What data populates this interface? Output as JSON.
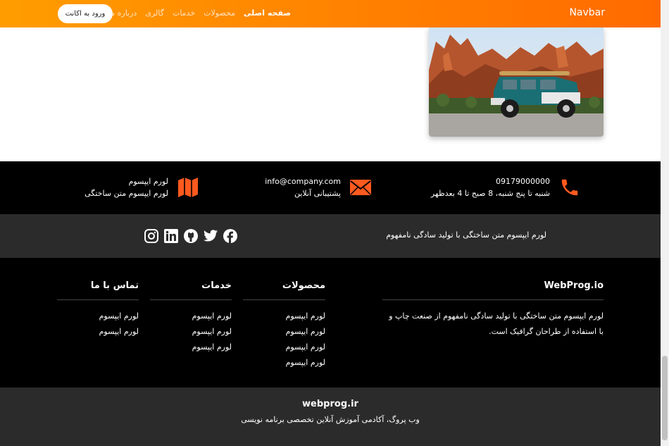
{
  "navbar": {
    "brand": "Navbar",
    "links": [
      "صفحه اصلی",
      "محصولات",
      "خدمات",
      "گالری",
      "درباره ما"
    ],
    "login_label": "ورود به اکانت",
    "accent_color": "#ff7a00"
  },
  "contact": {
    "phone": "09179000000",
    "hours": "شنبه تا پنج شنبه، 8 صبح تا 4 بعدظهر",
    "email": "info@company.com",
    "support": "پشتیبانی آنلاین",
    "address_title": "لورم ایپسوم",
    "address_text": "لورم ایپسوم متن ساختگی"
  },
  "social": {
    "text": "لورم ایپسوم متن ساختگی با تولید سادگی نامفهوم",
    "icons": [
      "facebook-icon",
      "twitter-icon",
      "github-icon",
      "linkedin-icon",
      "instagram-icon"
    ]
  },
  "footer": {
    "about_title": "WebProg.io",
    "about_text": "لورم ایپسوم متن ساختگی با تولید سادگی نامفهوم از صنعت چاپ و با استفاده از طراحان گرافیک است.",
    "products_title": "محصولات",
    "products": [
      "لورم ایپسوم",
      "لورم ایپسوم",
      "لورم ایپسوم",
      "لورم ایپسوم"
    ],
    "services_title": "خدمات",
    "services": [
      "لورم ایپسوم",
      "لورم ایپسوم",
      "لورم ایپسوم"
    ],
    "contact_title": "تماس با ما",
    "contact_links": [
      "لورم ایپسوم",
      "لورم ایپسوم"
    ]
  },
  "bottom": {
    "site": "webprog.ir",
    "tagline": "وب پروگ، آکادمی آموزش آنلاین تخصصی برنامه نویسی"
  }
}
